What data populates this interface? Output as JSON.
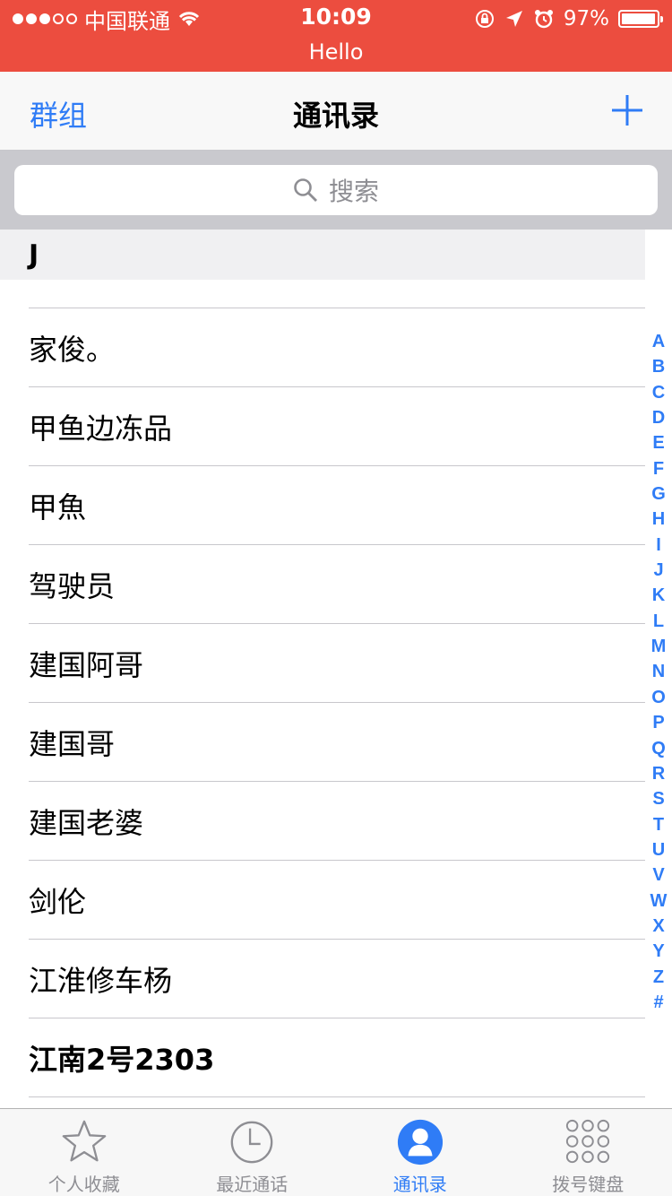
{
  "status_bar": {
    "carrier": "中国联通",
    "time": "10:09",
    "battery": "97%",
    "battery_level": 0.97,
    "banner": "Hello"
  },
  "nav": {
    "left_label": "群组",
    "title": "通讯录",
    "add_icon": "plus-icon"
  },
  "search": {
    "placeholder": "搜索",
    "icon": "search-icon"
  },
  "section": {
    "letter": "J"
  },
  "contacts": [
    {
      "name": "家俊。"
    },
    {
      "name": "甲鱼边冻品"
    },
    {
      "name": "甲魚"
    },
    {
      "name": "驾驶员"
    },
    {
      "name": "建国阿哥"
    },
    {
      "name": "建国哥"
    },
    {
      "name": "建国老婆"
    },
    {
      "name": "剑伦"
    },
    {
      "name": "江淮修车杨"
    },
    {
      "name": "江南2号2303"
    }
  ],
  "index_letters": [
    "A",
    "B",
    "C",
    "D",
    "E",
    "F",
    "G",
    "H",
    "I",
    "J",
    "K",
    "L",
    "M",
    "N",
    "O",
    "P",
    "Q",
    "R",
    "S",
    "T",
    "U",
    "V",
    "W",
    "X",
    "Y",
    "Z",
    "#"
  ],
  "tabs": [
    {
      "label": "个人收藏",
      "icon": "star-icon",
      "active": false
    },
    {
      "label": "最近通话",
      "icon": "clock-icon",
      "active": false
    },
    {
      "label": "通讯录",
      "icon": "contacts-icon",
      "active": true
    },
    {
      "label": "拨号键盘",
      "icon": "keypad-icon",
      "active": false
    }
  ],
  "colors": {
    "status_bar": "#ec4d3f",
    "accent": "#2f7cf6"
  }
}
